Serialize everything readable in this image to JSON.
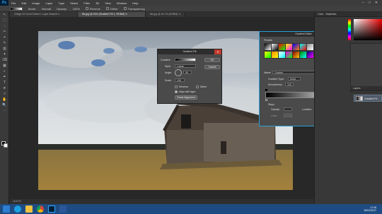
{
  "app": {
    "logo": "Ps",
    "menu": [
      "File",
      "Edit",
      "Image",
      "Layer",
      "Type",
      "Select",
      "Filter",
      "3D",
      "View",
      "Window",
      "Help"
    ],
    "window_controls": [
      "–",
      "□",
      "✕"
    ]
  },
  "options_bar": {
    "mode_label": "Mode:",
    "mode_value": "Normal",
    "opacity_label": "Opacity:",
    "opacity_value": "100%",
    "reverse_label": "Reverse",
    "dither_label": "Dither",
    "transparency_label": "Transparency"
  },
  "tabs": [
    {
      "label": "Village 32 Grunt Edited 1 Layer Mask/8 ✕",
      "active": false
    },
    {
      "label": "file.jpg @ 16% (Gradient Fill 1, RGB/8) ✕",
      "active": true
    },
    {
      "label": "file.jpg @ 16.7% (RGB/8) ✕",
      "active": false
    }
  ],
  "tools": [
    "↖",
    "⬚",
    "◌",
    "✂",
    "⌖",
    "✎",
    "▥",
    "✦",
    "⌫",
    "▦",
    "◐",
    "✒",
    "T",
    "➤",
    "□",
    "✋",
    "🔍",
    "⋯"
  ],
  "right_panel": {
    "color_tab": "Color",
    "swatches_tab": "Swatches",
    "layers_tab": "Layers",
    "layer_name": "Gradient Fil..."
  },
  "status": {
    "zoom": "16.67%"
  },
  "gradient_fill": {
    "title": "Gradient Fill",
    "gradient_label": "Gradient:",
    "style_label": "Style:",
    "style_value": "Linear",
    "angle_label": "Angle:",
    "angle_value": "90",
    "scale_label": "Scale:",
    "scale_value": "100",
    "reverse": "Reverse",
    "dither": "Dither",
    "align": "Align with layer",
    "reset": "Reset Alignment",
    "ok": "OK",
    "cancel": "Cancel"
  },
  "gradient_editor": {
    "title": "Gradient Editor",
    "presets_label": "Presets",
    "name_label": "Name:",
    "name_value": "Custom",
    "type_label": "Gradient Type:",
    "type_value": "Solid",
    "smooth_label": "Smoothness:",
    "smooth_value": "100",
    "stops_label": "Stops",
    "opacity_label": "Opacity:",
    "location_label": "Location:",
    "delete": "Delete",
    "color_label": "Color:",
    "ok": "OK",
    "cancel": "Cancel",
    "load": "Load...",
    "save": "Save...",
    "new": "New"
  },
  "taskbar": {
    "time": "17:49",
    "date": "25/01/2017"
  }
}
